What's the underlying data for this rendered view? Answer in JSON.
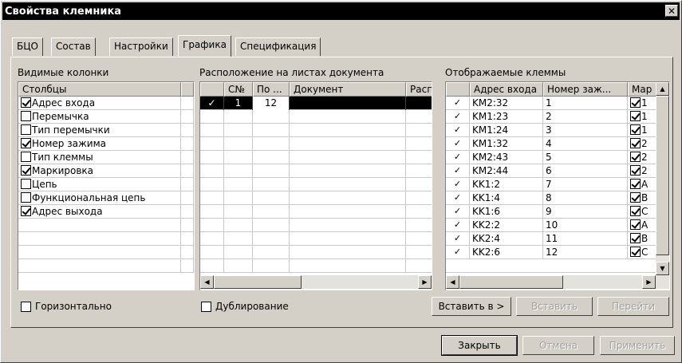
{
  "window": {
    "title": "Свойства клемника",
    "close": "✕"
  },
  "tabs": [
    "БЦО",
    "Состав",
    "Настройки",
    "Графика",
    "Спецификация"
  ],
  "visible_columns": {
    "label": "Видимые колонки",
    "header": "Столбцы",
    "items": [
      {
        "label": "Адрес входа",
        "checked": true
      },
      {
        "label": "Перемычка",
        "checked": false
      },
      {
        "label": "Тип перемычки",
        "checked": false
      },
      {
        "label": "Номер зажима",
        "checked": true
      },
      {
        "label": "Тип клеммы",
        "checked": false
      },
      {
        "label": "Маркировка",
        "checked": true
      },
      {
        "label": "Цепь",
        "checked": false
      },
      {
        "label": "Функциональная цепь",
        "checked": false
      },
      {
        "label": "Адрес выхода",
        "checked": true
      }
    ],
    "option": "Горизонтально"
  },
  "placement": {
    "label": "Расположение на листах документа",
    "headers": [
      "С№",
      "По ...",
      "Документ",
      "Расп"
    ],
    "rows": [
      {
        "check": "✓",
        "from": "1",
        "to": "12",
        "doc": ""
      }
    ],
    "option": "Дублирование"
  },
  "terminals": {
    "label": "Отображаемые клеммы",
    "headers": [
      "Адрес входа",
      "Номер заж...",
      "Мар"
    ],
    "rows": [
      {
        "check": "✓",
        "addr": "KM2:32",
        "num": "1",
        "mark": "1"
      },
      {
        "check": "✓",
        "addr": "KM1:23",
        "num": "2",
        "mark": "1"
      },
      {
        "check": "✓",
        "addr": "KM1:24",
        "num": "3",
        "mark": "1"
      },
      {
        "check": "✓",
        "addr": "KM1:32",
        "num": "4",
        "mark": "2"
      },
      {
        "check": "✓",
        "addr": "KM2:43",
        "num": "5",
        "mark": "2"
      },
      {
        "check": "✓",
        "addr": "KM2:44",
        "num": "6",
        "mark": "2"
      },
      {
        "check": "✓",
        "addr": "KK1:2",
        "num": "7",
        "mark": "A"
      },
      {
        "check": "✓",
        "addr": "KK1:4",
        "num": "8",
        "mark": "B"
      },
      {
        "check": "✓",
        "addr": "KK1:6",
        "num": "9",
        "mark": "C"
      },
      {
        "check": "✓",
        "addr": "KK2:2",
        "num": "10",
        "mark": "A"
      },
      {
        "check": "✓",
        "addr": "KK2:4",
        "num": "11",
        "mark": "B"
      },
      {
        "check": "✓",
        "addr": "KK2:6",
        "num": "12",
        "mark": "C"
      }
    ],
    "buttons": {
      "insert_to": "Вставить в >",
      "insert": "Вставить",
      "goto": "Перейти"
    }
  },
  "footer": {
    "close": "Закрыть",
    "cancel": "Отмена",
    "apply": "Применить"
  },
  "icons": {
    "scroll_left": "◀",
    "scroll_right": "▶",
    "scroll_up": "▲",
    "scroll_down": "▼"
  }
}
